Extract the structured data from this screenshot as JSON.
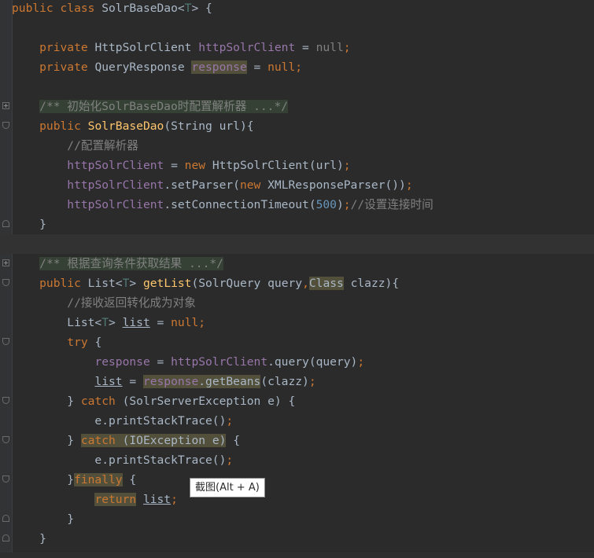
{
  "lines": [
    {
      "tokens": [
        {
          "t": "public class ",
          "c": "kw"
        },
        {
          "t": "SolrBaseDao<",
          "c": ""
        },
        {
          "t": "T",
          "c": "tp"
        },
        {
          "t": "> {",
          "c": ""
        }
      ]
    },
    {
      "tokens": []
    },
    {
      "tokens": [
        {
          "t": "    private ",
          "c": "kw"
        },
        {
          "t": "HttpSolrClient ",
          "c": ""
        },
        {
          "t": "httpSolrClient",
          "c": "fld"
        },
        {
          "t": " = ",
          "c": ""
        },
        {
          "t": "null",
          "c": "cmt"
        },
        {
          "t": ";",
          "c": "kw"
        }
      ]
    },
    {
      "tokens": [
        {
          "t": "    private ",
          "c": "kw"
        },
        {
          "t": "QueryResponse ",
          "c": ""
        },
        {
          "t": "response",
          "c": "fld hl2"
        },
        {
          "t": " = ",
          "c": ""
        },
        {
          "t": "null",
          "c": "kw"
        },
        {
          "t": ";",
          "c": "kw"
        }
      ]
    },
    {
      "tokens": []
    },
    {
      "tokens": [
        {
          "t": "    ",
          "c": ""
        },
        {
          "t": "/** 初始化SolrBaseDao时配置解析器 ...*/",
          "c": "cmt hl"
        }
      ]
    },
    {
      "tokens": [
        {
          "t": "    public ",
          "c": "kw"
        },
        {
          "t": "SolrBaseDao",
          "c": "fn"
        },
        {
          "t": "(String url){",
          "c": ""
        }
      ]
    },
    {
      "tokens": [
        {
          "t": "        //配置解析器",
          "c": "cmt"
        }
      ]
    },
    {
      "tokens": [
        {
          "t": "        ",
          "c": ""
        },
        {
          "t": "httpSolrClient",
          "c": "fld"
        },
        {
          "t": " = ",
          "c": ""
        },
        {
          "t": "new ",
          "c": "kw"
        },
        {
          "t": "HttpSolrClient(url)",
          "c": ""
        },
        {
          "t": ";",
          "c": "kw"
        }
      ]
    },
    {
      "tokens": [
        {
          "t": "        ",
          "c": ""
        },
        {
          "t": "httpSolrClient",
          "c": "fld"
        },
        {
          "t": ".setParser(",
          "c": ""
        },
        {
          "t": "new ",
          "c": "kw"
        },
        {
          "t": "XMLResponseParser())",
          "c": ""
        },
        {
          "t": ";",
          "c": "kw"
        }
      ]
    },
    {
      "tokens": [
        {
          "t": "        ",
          "c": ""
        },
        {
          "t": "httpSolrClient",
          "c": "fld"
        },
        {
          "t": ".setConnectionTimeout(",
          "c": ""
        },
        {
          "t": "500",
          "c": "num"
        },
        {
          "t": ")",
          "c": ""
        },
        {
          "t": ";",
          "c": "kw"
        },
        {
          "t": "//设置连接时间",
          "c": "cmt"
        }
      ]
    },
    {
      "tokens": [
        {
          "t": "    }",
          "c": ""
        }
      ]
    },
    {
      "tokens": []
    },
    {
      "tokens": [
        {
          "t": "    ",
          "c": ""
        },
        {
          "t": "/** 根据查询条件获取结果 ...*/",
          "c": "cmt hl"
        }
      ]
    },
    {
      "tokens": [
        {
          "t": "    public ",
          "c": "kw"
        },
        {
          "t": "List<",
          "c": ""
        },
        {
          "t": "T",
          "c": "tp"
        },
        {
          "t": "> ",
          "c": ""
        },
        {
          "t": "getList",
          "c": "fn"
        },
        {
          "t": "(SolrQuery query",
          "c": ""
        },
        {
          "t": ",",
          "c": "kw"
        },
        {
          "t": "Class",
          "c": "hl2"
        },
        {
          "t": " clazz){",
          "c": ""
        }
      ]
    },
    {
      "tokens": [
        {
          "t": "        //接收返回转化成为对象",
          "c": "cmt"
        }
      ]
    },
    {
      "tokens": [
        {
          "t": "        List<",
          "c": ""
        },
        {
          "t": "T",
          "c": "tp"
        },
        {
          "t": "> ",
          "c": ""
        },
        {
          "t": "list",
          "c": "ul"
        },
        {
          "t": " = ",
          "c": ""
        },
        {
          "t": "null",
          "c": "kw"
        },
        {
          "t": ";",
          "c": "kw"
        }
      ]
    },
    {
      "tokens": [
        {
          "t": "        try ",
          "c": "kw"
        },
        {
          "t": "{",
          "c": ""
        }
      ]
    },
    {
      "tokens": [
        {
          "t": "            ",
          "c": ""
        },
        {
          "t": "response",
          "c": "fld"
        },
        {
          "t": " = ",
          "c": ""
        },
        {
          "t": "httpSolrClient",
          "c": "fld"
        },
        {
          "t": ".query(query)",
          "c": ""
        },
        {
          "t": ";",
          "c": "kw"
        }
      ]
    },
    {
      "tokens": [
        {
          "t": "            ",
          "c": ""
        },
        {
          "t": "list",
          "c": "ul"
        },
        {
          "t": " = ",
          "c": ""
        },
        {
          "t": "response",
          "c": "fld hl2"
        },
        {
          "t": ".getBeans",
          "c": "hl2"
        },
        {
          "t": "(clazz)",
          "c": ""
        },
        {
          "t": ";",
          "c": "kw"
        }
      ]
    },
    {
      "tokens": [
        {
          "t": "        } ",
          "c": ""
        },
        {
          "t": "catch ",
          "c": "kw"
        },
        {
          "t": "(SolrServerException e) {",
          "c": ""
        }
      ]
    },
    {
      "tokens": [
        {
          "t": "            e.printStackTrace()",
          "c": ""
        },
        {
          "t": ";",
          "c": "kw"
        }
      ]
    },
    {
      "tokens": [
        {
          "t": "        } ",
          "c": ""
        },
        {
          "t": "catch",
          "c": "kw hl2"
        },
        {
          "t": " (IOException e)",
          "c": "hl2"
        },
        {
          "t": " {",
          "c": ""
        }
      ]
    },
    {
      "tokens": [
        {
          "t": "            e.printStackTrace()",
          "c": ""
        },
        {
          "t": ";",
          "c": "kw"
        }
      ]
    },
    {
      "tokens": [
        {
          "t": "        }",
          "c": ""
        },
        {
          "t": "finally",
          "c": "kw hl2"
        },
        {
          "t": " {",
          "c": ""
        }
      ]
    },
    {
      "tokens": [
        {
          "t": "            ",
          "c": ""
        },
        {
          "t": "return",
          "c": "kw hl2"
        },
        {
          "t": " ",
          "c": ""
        },
        {
          "t": "list",
          "c": "ul"
        },
        {
          "t": ";",
          "c": "kw"
        }
      ]
    },
    {
      "tokens": [
        {
          "t": "        }",
          "c": ""
        }
      ]
    },
    {
      "tokens": [
        {
          "t": "    }",
          "c": ""
        }
      ]
    }
  ],
  "tooltip": {
    "text": "截图(Alt + A)"
  }
}
